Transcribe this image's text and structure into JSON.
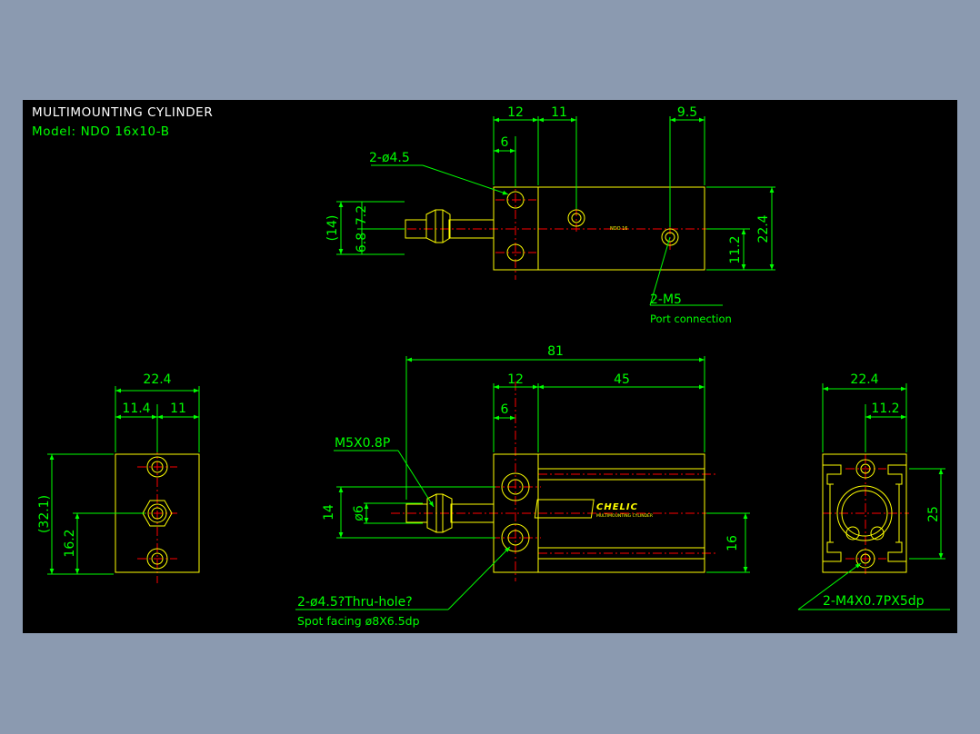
{
  "header": {
    "title": "MULTIMOUNTING CYLINDER",
    "model": "Model: NDO 16x10-B"
  },
  "colors": {
    "background": "#000000",
    "outline": "#ffff00",
    "dimension": "#00ff00",
    "centerline": "#ff0000",
    "desktop": "#8b9ab0",
    "title_text": "#ffffff"
  },
  "top_view": {
    "dim_12": "12",
    "dim_11": "11",
    "dim_9_5": "9.5",
    "dim_6": "6",
    "hole_label": "2-ø4.5",
    "dim_14": "(14)",
    "dim_6_8": "6.8",
    "dim_7_2": "7.2",
    "dim_22_4": "22.4",
    "dim_11_2": "11.2",
    "body_label": "NDO 16",
    "port_label": "2-M5",
    "port_note": "Port connection"
  },
  "left_view": {
    "dim_22_4": "22.4",
    "dim_11_4": "11.4",
    "dim_11": "11",
    "dim_32_1": "(32.1)",
    "dim_16_2": "16.2"
  },
  "front_view": {
    "dim_81": "81",
    "dim_12": "12",
    "dim_45": "45",
    "dim_6": "6",
    "thread_label": "M5X0.8P",
    "dim_14": "14",
    "dim_phi6": "ø6",
    "dim_16": "16",
    "hole_label": "2-ø4.5?Thru-hole?",
    "spot_label": "Spot facing  ø8X6.5dp",
    "logo": "CHELIC",
    "logo_sub": "MULTIMOUNTING CYLINDER"
  },
  "right_view": {
    "dim_22_4": "22.4",
    "dim_11_2": "11.2",
    "dim_25": "25",
    "tap_label": "2-M4X0.7PX5dp"
  }
}
